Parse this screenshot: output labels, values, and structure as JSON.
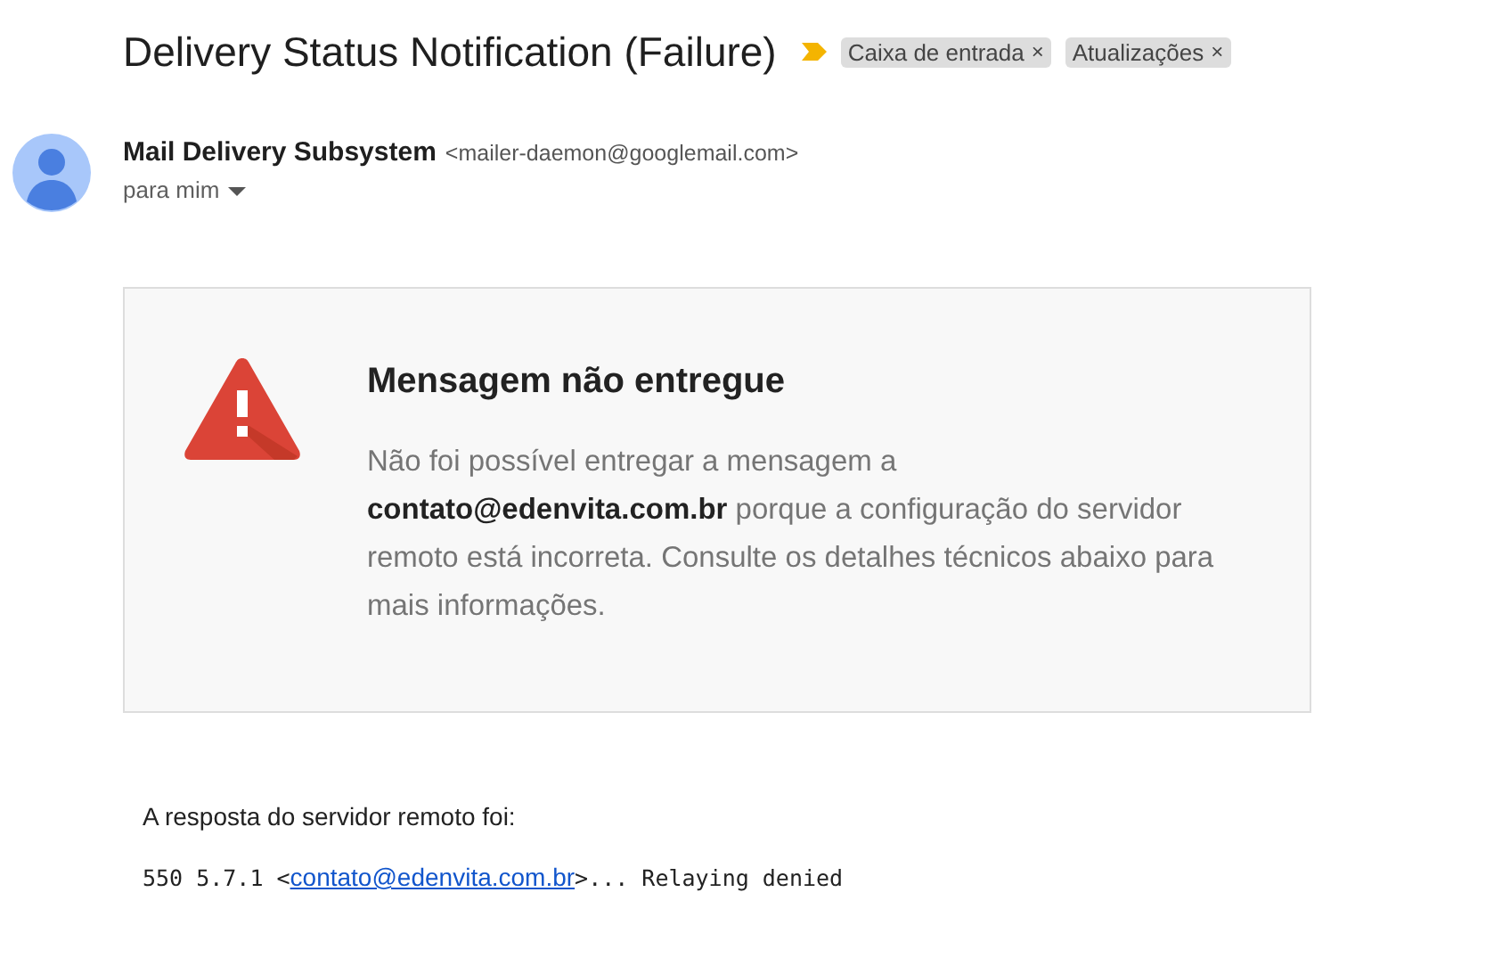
{
  "subject": "Delivery Status Notification (Failure)",
  "labels": [
    {
      "text": "Caixa de entrada",
      "remove": "×"
    },
    {
      "text": "Atualizações",
      "remove": "×"
    }
  ],
  "sender": {
    "name": "Mail Delivery Subsystem",
    "address": "<mailer-daemon@googlemail.com>",
    "recipient": "para mim"
  },
  "notice": {
    "heading": "Mensagem não entregue",
    "body": "Não foi possível entregar a mensagem a **contato@edenvita.com.br** porque a configuração do servidor remoto está incorreta. Consulte os detalhes técnicos abaixo para mais informações."
  },
  "response": {
    "intro": "A resposta do servidor remoto foi:",
    "prefix": "550 5.7.1 <",
    "link": "contato@edenvita.com.br",
    "suffix": ">... Relaying denied"
  }
}
